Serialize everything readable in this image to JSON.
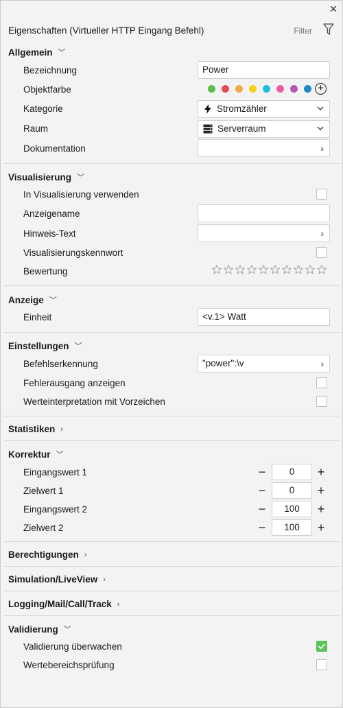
{
  "header": {
    "title": "Eigenschaften (Virtueller HTTP Eingang Befehl)",
    "filter_label": "Filter"
  },
  "sections": {
    "allgemein": "Allgemein",
    "visualisierung": "Visualisierung",
    "anzeige": "Anzeige",
    "einstellungen": "Einstellungen",
    "statistiken": "Statistiken",
    "korrektur": "Korrektur",
    "berechtigungen": "Berechtigungen",
    "simulation": "Simulation/LiveView",
    "logging": "Logging/Mail/Call/Track",
    "validierung": "Validierung"
  },
  "allgemein": {
    "bezeichnung_label": "Bezeichnung",
    "bezeichnung_value": "Power",
    "objektfarbe_label": "Objektfarbe",
    "colors": [
      "#5bbd4f",
      "#e74c55",
      "#f0a94a",
      "#f5d31b",
      "#1fbfdc",
      "#ea5ea0",
      "#b456b4",
      "#1a8bc4"
    ],
    "kategorie_label": "Kategorie",
    "kategorie_value": "Stromzähler",
    "raum_label": "Raum",
    "raum_value": "Serverraum",
    "dokumentation_label": "Dokumentation"
  },
  "visualisierung": {
    "verwenden_label": "In Visualisierung verwenden",
    "anzeigename_label": "Anzeigename",
    "hinweis_label": "Hinweis-Text",
    "kennwort_label": "Visualisierungskennwort",
    "bewertung_label": "Bewertung",
    "rating": 0,
    "rating_max": 10
  },
  "anzeige": {
    "einheit_label": "Einheit",
    "einheit_value": "<v.1> Watt"
  },
  "einstellungen": {
    "befehl_label": "Befehlserkennung",
    "befehl_value": "\"power\":\\v",
    "fehler_label": "Fehlerausgang anzeigen",
    "vorzeichen_label": "Werteinterpretation mit Vorzeichen"
  },
  "korrektur": {
    "rows": [
      {
        "label": "Eingangswert 1",
        "value": "0"
      },
      {
        "label": "Zielwert 1",
        "value": "0"
      },
      {
        "label": "Eingangswert 2",
        "value": "100"
      },
      {
        "label": "Zielwert 2",
        "value": "100"
      }
    ]
  },
  "validierung": {
    "ueberwachen_label": "Validierung überwachen",
    "ueberwachen_checked": true,
    "bereich_label": "Wertebereichsprüfung",
    "bereich_checked": false
  }
}
